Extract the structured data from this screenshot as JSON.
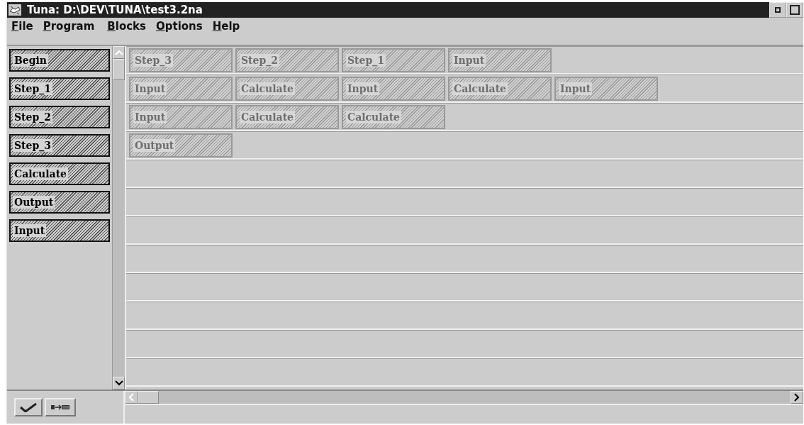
{
  "window": {
    "title": "Tuna: D:\\DEV\\TUNA\\test3.2na"
  },
  "menu": [
    "File",
    "Program",
    "Blocks",
    "Options",
    "Help"
  ],
  "palette": [
    "Begin",
    "Step_1",
    "Step_2",
    "Step_3",
    "Calculate",
    "Output",
    "Input"
  ],
  "program_rows": [
    [
      "Step_3",
      "Step_2",
      "Step_1",
      "Input"
    ],
    [
      "Input",
      "Calculate",
      "Input",
      "Calculate",
      "Input"
    ],
    [
      "Input",
      "Calculate",
      "Calculate"
    ],
    [
      "Output"
    ]
  ]
}
